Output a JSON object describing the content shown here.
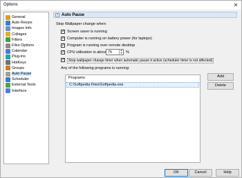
{
  "window": {
    "title": "Options",
    "close_glyph": "✕"
  },
  "sidebar": {
    "items": [
      {
        "label": "General",
        "icon": "general-icon",
        "color": "#d9a300"
      },
      {
        "label": "Auto Resize",
        "icon": "auto-resize-icon",
        "color": "#3b7bd6"
      },
      {
        "label": "Images Info",
        "icon": "images-info-icon",
        "color": "#6a8fd0"
      },
      {
        "label": "Collages",
        "icon": "collages-icon",
        "color": "#e0b020"
      },
      {
        "label": "Filters",
        "icon": "filters-icon",
        "color": "#40a040"
      },
      {
        "label": "Files Options",
        "icon": "files-options-icon",
        "color": "#8a8a8a"
      },
      {
        "label": "Calendar",
        "icon": "calendar-icon",
        "color": "#4a7ad0"
      },
      {
        "label": "Plug-ins",
        "icon": "plug-ins-icon",
        "color": "#2aa0a0"
      },
      {
        "label": "HotKeys",
        "icon": "hotkeys-icon",
        "color": "#707070"
      },
      {
        "label": "Groups",
        "icon": "groups-icon",
        "color": "#c08030"
      },
      {
        "label": "Auto Pause",
        "icon": "auto-pause-icon",
        "color": "#a0a0a0"
      },
      {
        "label": "Scheduler",
        "icon": "scheduler-icon",
        "color": "#3080c0"
      },
      {
        "label": "External Tools",
        "icon": "external-tools-icon",
        "color": "#50a050"
      },
      {
        "label": "Interface",
        "icon": "interface-icon",
        "color": "#5080d0"
      }
    ],
    "selected_index": 10
  },
  "section": {
    "title": "Auto Pause",
    "intro": "Stop Wallpaper change when:"
  },
  "options": {
    "screensaver": "Screen saver is running",
    "battery": "Computer is running on battery power (for laptops)",
    "remote": "Program is running over remote desktop",
    "cpu": "CPU utilization is above:",
    "cpu_value": "75",
    "cpu_unit": "%",
    "timer": "Stop wallpaper change timer when automatic pause it active (scheduler timer is not affected)"
  },
  "programs": {
    "intro": "Any of the following programs is running:",
    "column": "Programs",
    "rows": [
      "C:\\Softpedia Files\\Softpedia.exe"
    ],
    "add_label": "Add",
    "delete_label": "Delete"
  },
  "footer": {
    "ok_label": "OK",
    "cancel_label": "Cancel",
    "help_label": "Help"
  }
}
